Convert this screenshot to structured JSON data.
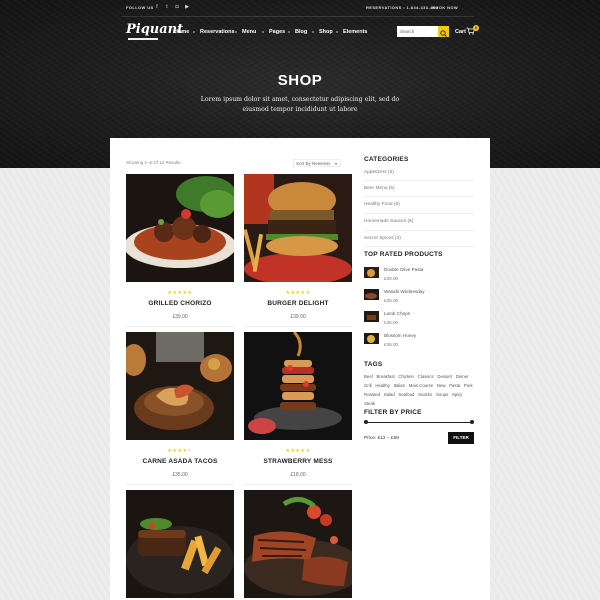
{
  "topbar": {
    "follow_label": "FOLLOW US",
    "social": [
      {
        "icon": "facebook-icon",
        "glyph": "f"
      },
      {
        "icon": "twitter-icon",
        "glyph": "t"
      },
      {
        "icon": "instagram-icon",
        "glyph": "◘"
      },
      {
        "icon": "youtube-icon",
        "glyph": "▶"
      }
    ],
    "reservations_label": "RESERVATIONS • 1-844-333-459",
    "book_label": "BOOK NOW"
  },
  "nav": {
    "logo": "Piquant",
    "items": [
      "Home",
      "Reservations",
      "Menu",
      "Pages",
      "Blog",
      "Shop",
      "Elements"
    ],
    "search_placeholder": "Search",
    "cart_label": "Cart",
    "cart_count": "0"
  },
  "hero": {
    "title": "SHOP",
    "subtitle": "Lorem ipsum dolor sit amet, consectetur adipiscing elit, sed do eiusmod tempor incididunt ut labore"
  },
  "shop": {
    "showing": "Showing 1–6 Of 12 Results",
    "sort_label": "Sort By Newness",
    "products": [
      {
        "name": "GRILLED CHORIZO",
        "price": "£39.00",
        "rating": 5,
        "image": "steak-stew"
      },
      {
        "name": "BURGER DELIGHT",
        "price": "£39.00",
        "rating": 5,
        "image": "burger"
      },
      {
        "name": "CARNE ASADA TACOS",
        "price": "£35.00",
        "rating": 4,
        "image": "tacos-board"
      },
      {
        "name": "STRAWBERRY MESS",
        "price": "£18.00",
        "rating": 5,
        "image": "pancake-stack"
      },
      {
        "name": "",
        "price": "",
        "rating": 0,
        "image": "steak-fries"
      },
      {
        "name": "",
        "price": "",
        "rating": 0,
        "image": "grilled-steak"
      }
    ]
  },
  "sidebar": {
    "categories_title": "CATEGORIES",
    "categories": [
      "Appetizers (5)",
      "Beer Menu (5)",
      "Healthy Food (6)",
      "Homemade Sauces (6)",
      "Secret Spices (3)"
    ],
    "top_rated_title": "TOP RATED PRODUCTS",
    "top_rated": [
      {
        "name": "Double Olive Pasta",
        "price": "£39.00"
      },
      {
        "name": "Wasabi Wednesday",
        "price": "£39.00"
      },
      {
        "name": "Lamb Chops",
        "price": "£35.00"
      },
      {
        "name": "Blossom Honey",
        "price": "£39.00"
      }
    ],
    "tags_title": "TAGS",
    "tags": [
      "Beef",
      "Breakfast",
      "Chicken",
      "Classics",
      "Dessert",
      "Dinner",
      "Grill",
      "Healthy",
      "Italian",
      "Main Course",
      "New",
      "Pasta",
      "Pork",
      "Roasted",
      "Salad",
      "Seafood",
      "Snacks",
      "Soups",
      "Spicy",
      "Steak"
    ],
    "filter_title": "FILTER BY PRICE",
    "price_range": "Price: £12 – £59",
    "filter_button": "FILTER"
  },
  "colors": {
    "accent": "#f6c90e",
    "dark": "#111111"
  }
}
